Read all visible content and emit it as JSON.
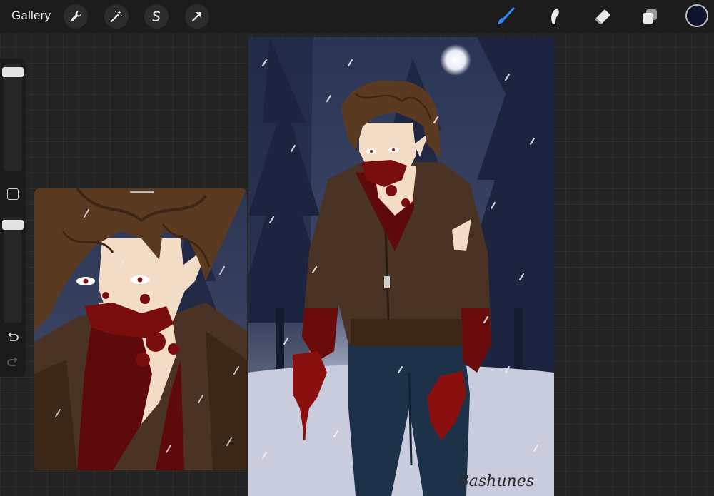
{
  "topbar": {
    "gallery_label": "Gallery",
    "left_tools": [
      "wrench-icon",
      "magic-wand-icon",
      "selection-s-icon",
      "transform-arrow-icon"
    ],
    "right_tools": [
      "brush-icon",
      "smudge-icon",
      "eraser-icon",
      "layers-icon"
    ],
    "active_tool": "brush",
    "current_color": "#0d1530",
    "accent_color": "#2f8cff"
  },
  "sidebar": {
    "brush_size_level": 0.95,
    "opacity_level": 0.95,
    "buttons": [
      "modify-square-icon",
      "undo-icon",
      "redo-icon"
    ]
  },
  "canvas": {
    "signature": "Bashunes"
  },
  "colors": {
    "background": "#232323",
    "sky": "#1d2744",
    "snow": "#c9ccdc",
    "jacket": "#4a3324",
    "blood": "#7a0d0d",
    "jeans": "#1d3248",
    "skin": "#f3dcc5",
    "hair": "#5b3a22"
  }
}
